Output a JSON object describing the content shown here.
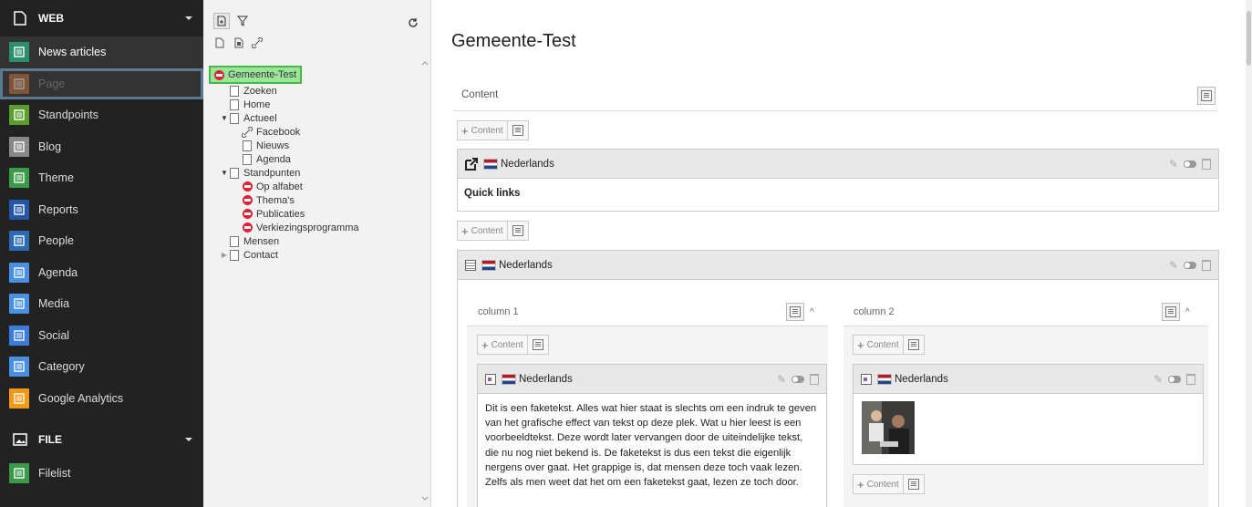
{
  "modmenu": {
    "web_group": "WEB",
    "items": [
      {
        "label": "News articles",
        "color": "#2a8f6a",
        "icon": "list-icon"
      },
      {
        "label": "Page",
        "color": "#c07238",
        "icon": "page-icon"
      },
      {
        "label": "Standpoints",
        "color": "#5a9e2f",
        "icon": "puzzle-icon"
      },
      {
        "label": "Blog",
        "color": "#888888",
        "icon": "list-icon"
      },
      {
        "label": "Theme",
        "color": "#3a9a4a",
        "icon": "cloud-icon"
      },
      {
        "label": "Reports",
        "color": "#2457a5",
        "icon": "report-icon"
      },
      {
        "label": "People",
        "color": "#2d6cb3",
        "icon": "people-icon"
      },
      {
        "label": "Agenda",
        "color": "#4a90e2",
        "icon": "calendar-icon"
      },
      {
        "label": "Media",
        "color": "#4a90e2",
        "icon": "calendar-icon"
      },
      {
        "label": "Social",
        "color": "#3b7dd8",
        "icon": "user-icon"
      },
      {
        "label": "Category",
        "color": "#4a90e2",
        "icon": "calendar-icon"
      },
      {
        "label": "Google Analytics",
        "color": "#f09a1a",
        "icon": "graph-icon"
      }
    ],
    "file_group": "FILE",
    "file_items": [
      {
        "label": "Filelist",
        "color": "#3a9a4a",
        "icon": "cloud-file-icon"
      }
    ]
  },
  "tree": {
    "root": "Gemeente-Test",
    "nodes": [
      {
        "label": "Zoeken",
        "indent": 1,
        "icon": "page"
      },
      {
        "label": "Home",
        "indent": 1,
        "icon": "page"
      },
      {
        "label": "Actueel",
        "indent": 1,
        "icon": "page",
        "toggle": "open"
      },
      {
        "label": "Facebook",
        "indent": 2,
        "icon": "link"
      },
      {
        "label": "Nieuws",
        "indent": 2,
        "icon": "page"
      },
      {
        "label": "Agenda",
        "indent": 2,
        "icon": "page"
      },
      {
        "label": "Standpunten",
        "indent": 1,
        "icon": "page",
        "toggle": "open"
      },
      {
        "label": "Op alfabet",
        "indent": 2,
        "icon": "red"
      },
      {
        "label": "Thema's",
        "indent": 2,
        "icon": "red"
      },
      {
        "label": "Publicaties",
        "indent": 2,
        "icon": "red"
      },
      {
        "label": "Verkiezingsprogramma",
        "indent": 2,
        "icon": "red"
      },
      {
        "label": "Mensen",
        "indent": 1,
        "icon": "page"
      },
      {
        "label": "Contact",
        "indent": 1,
        "icon": "page",
        "toggle": "closed"
      }
    ]
  },
  "main": {
    "title": "Gemeente-Test",
    "content_label": "Content",
    "add_content": "Content",
    "lang": "Nederlands",
    "quick_links": "Quick links",
    "col1": "column 1",
    "col2": "column 2",
    "body_text": "Dit is een faketekst. Alles wat hier staat is slechts om een indruk te geven van het grafische effect van tekst op deze plek. Wat u hier leest is een voorbeeldtekst. Deze wordt later vervangen door de uiteindelijke tekst, die nu nog niet bekend is. De faketekst is dus een tekst die eigenlijk nergens over gaat. Het grappige is, dat mensen deze toch vaak lezen. Zelfs als men weet dat het om een faketekst gaat, lezen ze toch door."
  }
}
